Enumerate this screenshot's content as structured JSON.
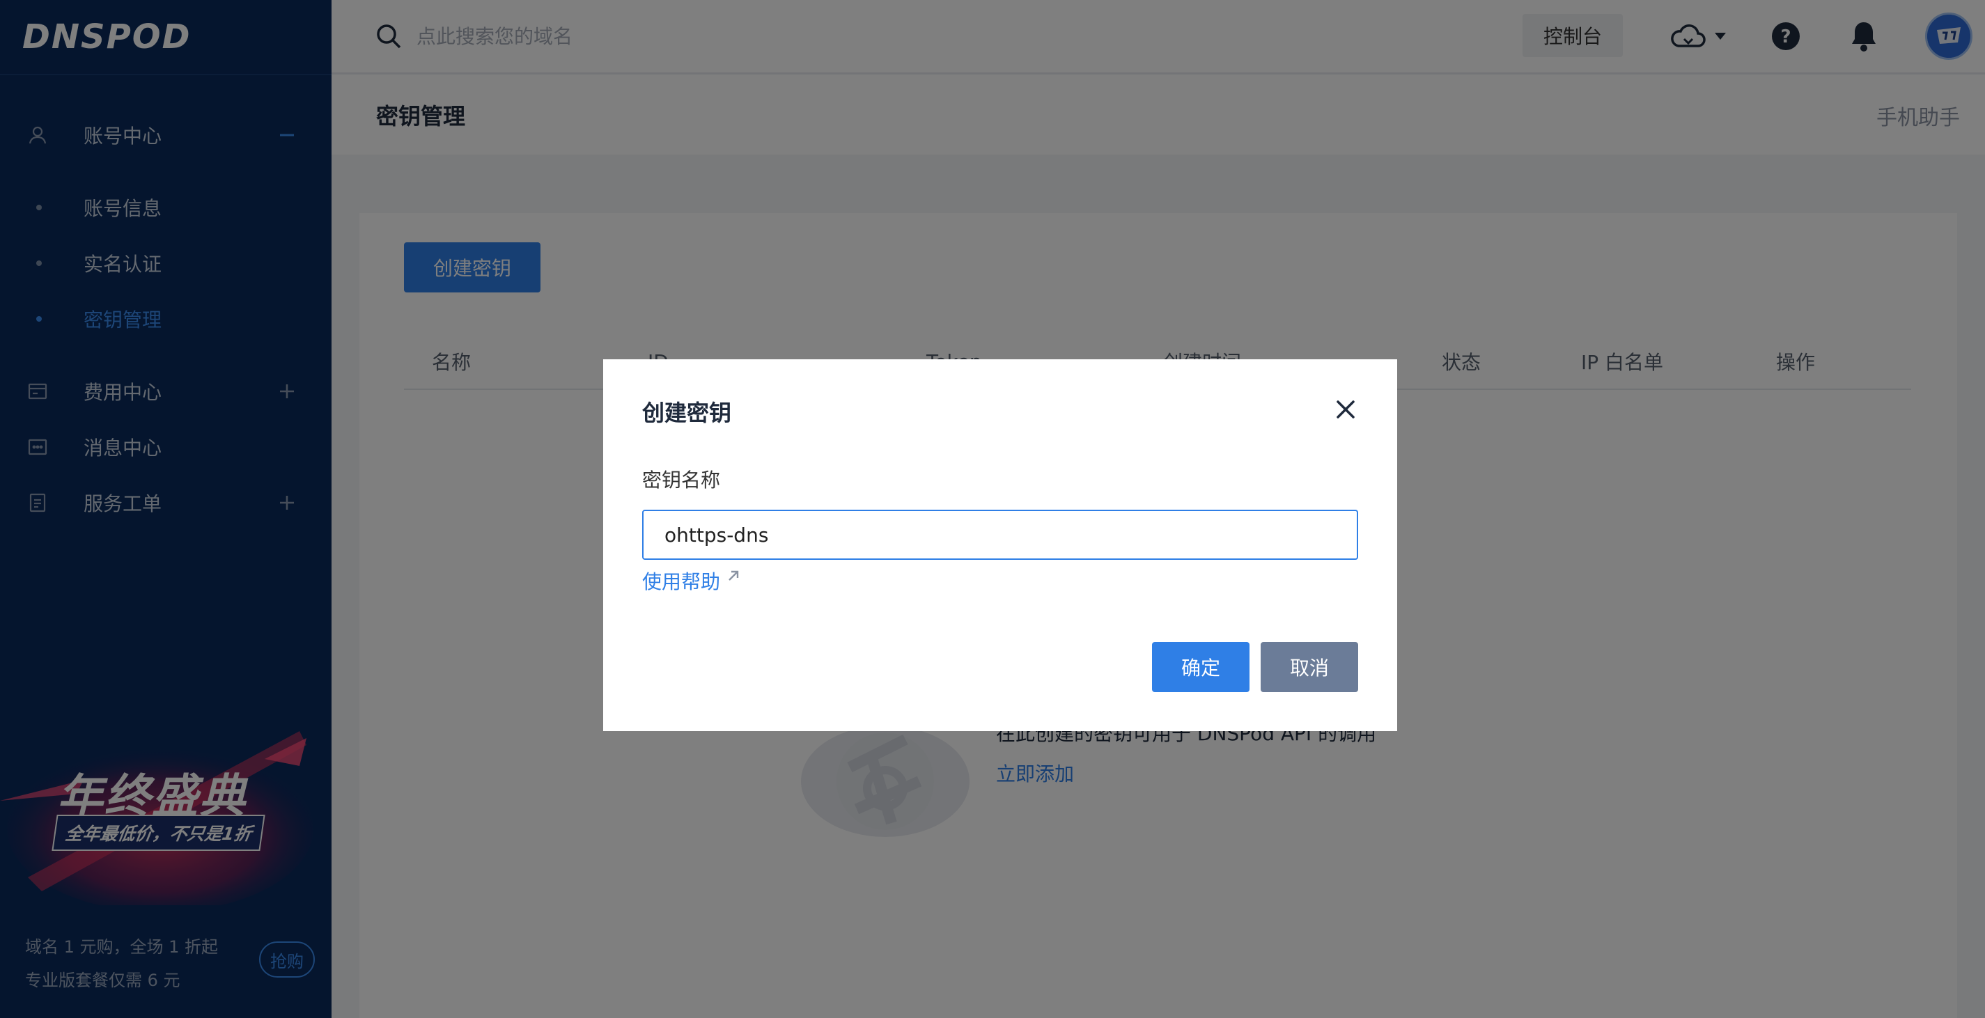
{
  "brand": {
    "logo_text": "DNSPOD"
  },
  "sidebar": {
    "groups": [
      {
        "label": "账号中心",
        "icon": "user-icon",
        "toggle": "minus"
      },
      {
        "label": "费用中心",
        "icon": "wallet-icon",
        "toggle": "plus"
      },
      {
        "label": "消息中心",
        "icon": "message-icon",
        "toggle": ""
      },
      {
        "label": "服务工单",
        "icon": "ticket-icon",
        "toggle": "plus"
      }
    ],
    "account_items": [
      {
        "label": "账号信息",
        "active": false
      },
      {
        "label": "实名认证",
        "active": false
      },
      {
        "label": "密钥管理",
        "active": true
      }
    ],
    "promo": {
      "title": "年终盛典",
      "subtitle": "全年最低价，不只是1折"
    },
    "bottom": {
      "line1": "域名 1 元购，全场 1 折起",
      "line2": "专业版套餐仅需 6 元",
      "grab_label": "抢购"
    }
  },
  "topbar": {
    "search_placeholder": "点此搜索您的域名",
    "console_label": "控制台"
  },
  "page": {
    "title": "密钥管理",
    "mobile_helper": "手机助手",
    "create_button": "创建密钥",
    "columns": [
      "名称",
      "ID",
      "Token",
      "创建时间",
      "状态",
      "IP 白名单",
      "操作"
    ],
    "empty_text": "在此创建的密钥可用于 DNSPod API 的调用",
    "empty_link": "立即添加"
  },
  "modal": {
    "title": "创建密钥",
    "field_label": "密钥名称",
    "field_value": "ohttps-dns",
    "help_link": "使用帮助",
    "ok_label": "确定",
    "cancel_label": "取消"
  },
  "colors": {
    "sidebar_bg": "#0a2a5c",
    "accent": "#2f7fe6",
    "cancel_bg": "#6b7c98"
  }
}
